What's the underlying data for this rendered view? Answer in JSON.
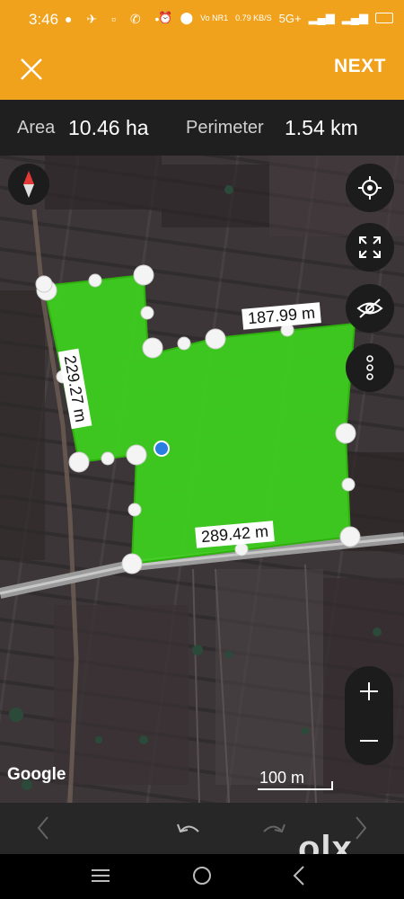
{
  "status": {
    "time": "3:46",
    "data_rate": "0.79 KB/S",
    "network": "5G+",
    "carrier_tag": "Vo NR1"
  },
  "toolbar": {
    "next_label": "NEXT"
  },
  "stats": {
    "area_label": "Area",
    "area_value": "10.46 ha",
    "perimeter_label": "Perimeter",
    "perimeter_value": "1.54 km"
  },
  "map": {
    "edge_labels": {
      "west": "229.27 m",
      "north": "187.99 m",
      "south": "289.42 m"
    },
    "attribution": "Google",
    "scale_label": "100 m",
    "polygon_fill": "#3fd21e",
    "accent": "#f0a21c"
  },
  "watermark": "olx",
  "icons": [
    "close-icon",
    "compass-icon",
    "my-location-icon",
    "fullscreen-icon",
    "visibility-off-icon",
    "more-vert-icon",
    "zoom-in-icon",
    "zoom-out-icon",
    "chevron-left-icon",
    "undo-icon",
    "redo-icon",
    "chevron-right-icon"
  ]
}
